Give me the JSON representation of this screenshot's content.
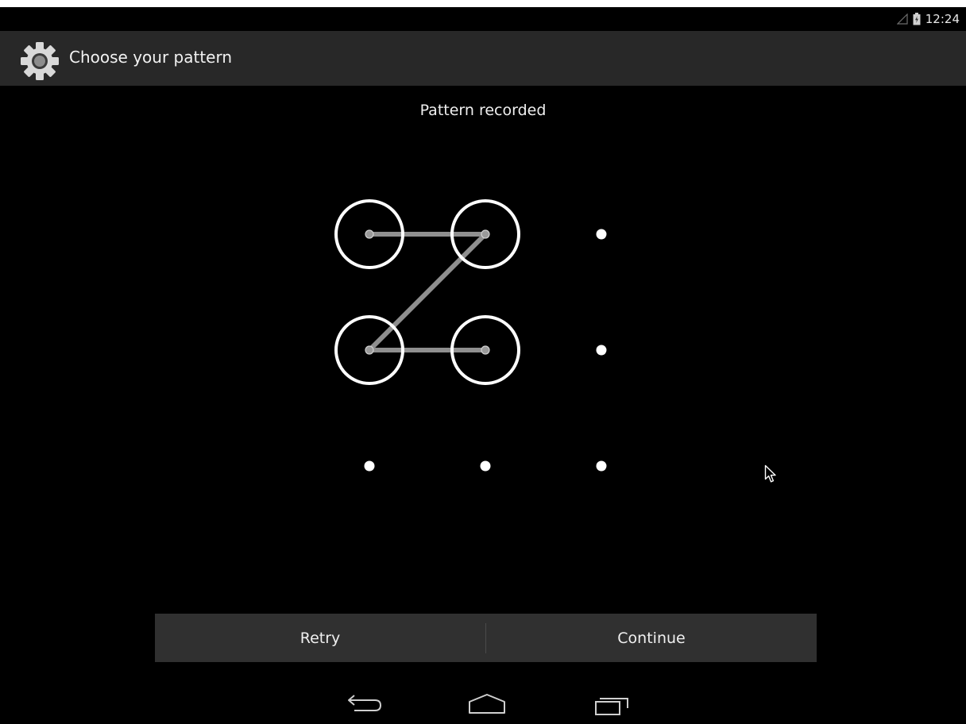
{
  "status_bar": {
    "time": "12:24"
  },
  "action_bar": {
    "title": "Choose your pattern",
    "icon": "gear-icon"
  },
  "header": {
    "message": "Pattern recorded"
  },
  "pattern": {
    "rows": 3,
    "cols": 3,
    "selected_cells": [
      [
        0,
        0
      ],
      [
        0,
        1
      ],
      [
        1,
        0
      ],
      [
        1,
        1
      ]
    ],
    "path": [
      [
        0,
        0
      ],
      [
        0,
        1
      ],
      [
        1,
        0
      ],
      [
        1,
        1
      ]
    ],
    "colors": {
      "ring": "#ffffff",
      "line": "#8f8f8f",
      "dot": "#ffffff"
    }
  },
  "footer": {
    "retry_label": "Retry",
    "continue_label": "Continue"
  },
  "nav": {
    "back_icon": "back-icon",
    "home_icon": "home-icon",
    "recents_icon": "recent-apps-icon"
  }
}
